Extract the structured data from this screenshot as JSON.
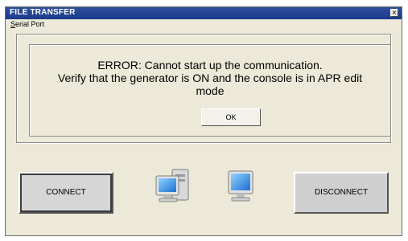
{
  "window": {
    "title": "FILE TRANSFER",
    "close_glyph": "×"
  },
  "menu": {
    "serial_port_first": "S",
    "serial_port_rest": "erial Port"
  },
  "error": {
    "line1": "ERROR: Cannot start up the communication.",
    "line2": "Verify that the generator is ON and the console is in APR edit",
    "line3": "mode",
    "ok_label": "OK"
  },
  "buttons": {
    "connect": "CONNECT",
    "disconnect": "DISCONNECT"
  },
  "icons": [
    "computer-with-tower-icon",
    "computer-icon"
  ]
}
